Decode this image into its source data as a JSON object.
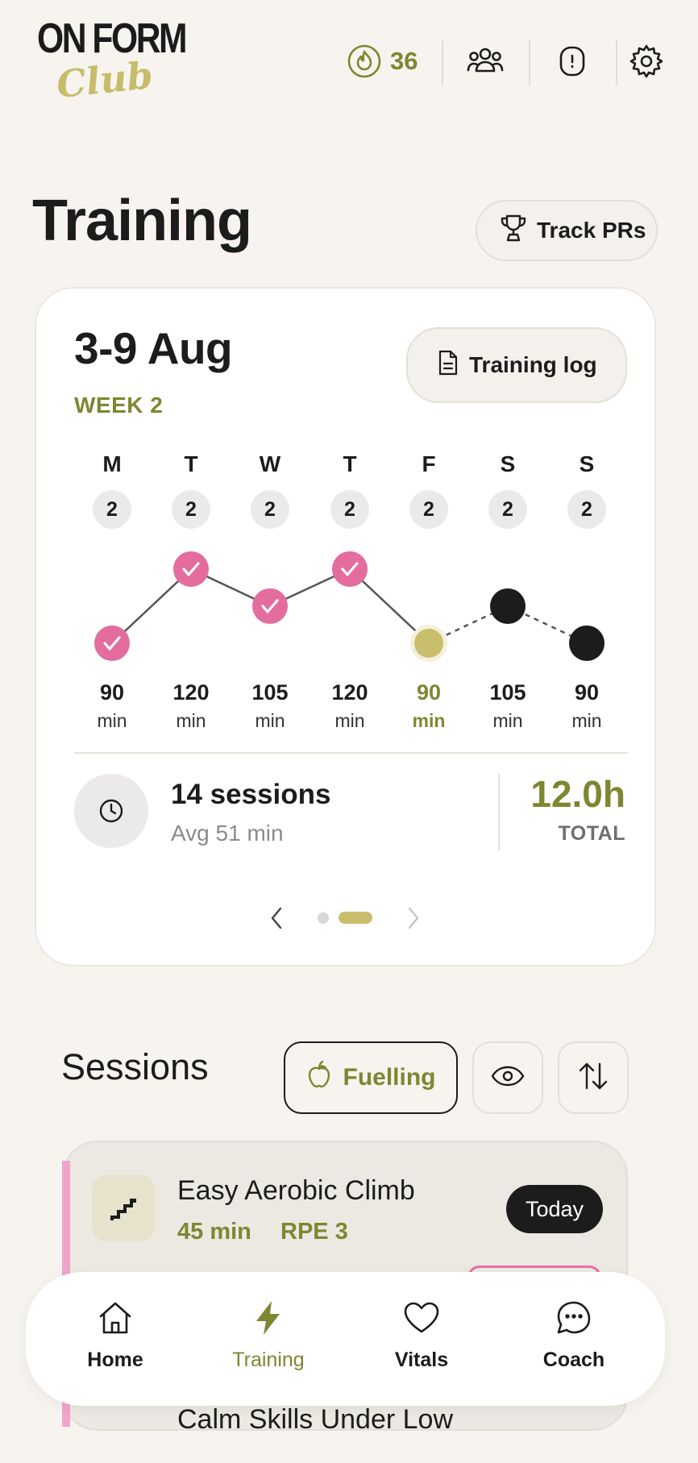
{
  "brand": {
    "logo_top": "ON FORM",
    "logo_script": "Club"
  },
  "header": {
    "streak_count": "36",
    "icons": [
      "flame-icon",
      "community-icon",
      "watch-icon",
      "gear-icon"
    ]
  },
  "page": {
    "title": "Training",
    "track_prs_label": "Track PRs"
  },
  "week_card": {
    "range": "3-9 Aug",
    "week_label": "WEEK 2",
    "training_log_label": "Training log",
    "days": [
      {
        "letter": "M",
        "sessions": "2",
        "mins": "90",
        "unit": "min",
        "status": "completed"
      },
      {
        "letter": "T",
        "sessions": "2",
        "mins": "120",
        "unit": "min",
        "status": "completed"
      },
      {
        "letter": "W",
        "sessions": "2",
        "mins": "105",
        "unit": "min",
        "status": "completed"
      },
      {
        "letter": "T",
        "sessions": "2",
        "mins": "120",
        "unit": "min",
        "status": "completed"
      },
      {
        "letter": "F",
        "sessions": "2",
        "mins": "90",
        "unit": "min",
        "status": "current"
      },
      {
        "letter": "S",
        "sessions": "2",
        "mins": "105",
        "unit": "min",
        "status": "planned"
      },
      {
        "letter": "S",
        "sessions": "2",
        "mins": "90",
        "unit": "min",
        "status": "planned"
      }
    ],
    "summary": {
      "sessions": "14 sessions",
      "avg": "Avg 51 min",
      "total_value": "12.0h",
      "total_label": "TOTAL"
    },
    "pager": {
      "pages": 2,
      "active": 2
    }
  },
  "sessions_section": {
    "title": "Sessions",
    "fuelling_label": "Fuelling",
    "session": {
      "title": "Easy Aerobic Climb",
      "duration": "45 min",
      "rpe": "RPE 3",
      "badge": "Today"
    },
    "next_session_title": "Calm Skills Under Low"
  },
  "nav": [
    {
      "label": "Home",
      "icon": "home-icon",
      "active": false
    },
    {
      "label": "Training",
      "icon": "lightning-icon",
      "active": true
    },
    {
      "label": "Vitals",
      "icon": "heart-icon",
      "active": false
    },
    {
      "label": "Coach",
      "icon": "chat-icon",
      "active": false
    }
  ],
  "colors": {
    "background": "#F7F4EF",
    "accent_olive": "#7F8631",
    "accent_gold": "#C9BE6C",
    "completed_pink": "#E46C9F",
    "planned_black": "#1C1C1C"
  }
}
